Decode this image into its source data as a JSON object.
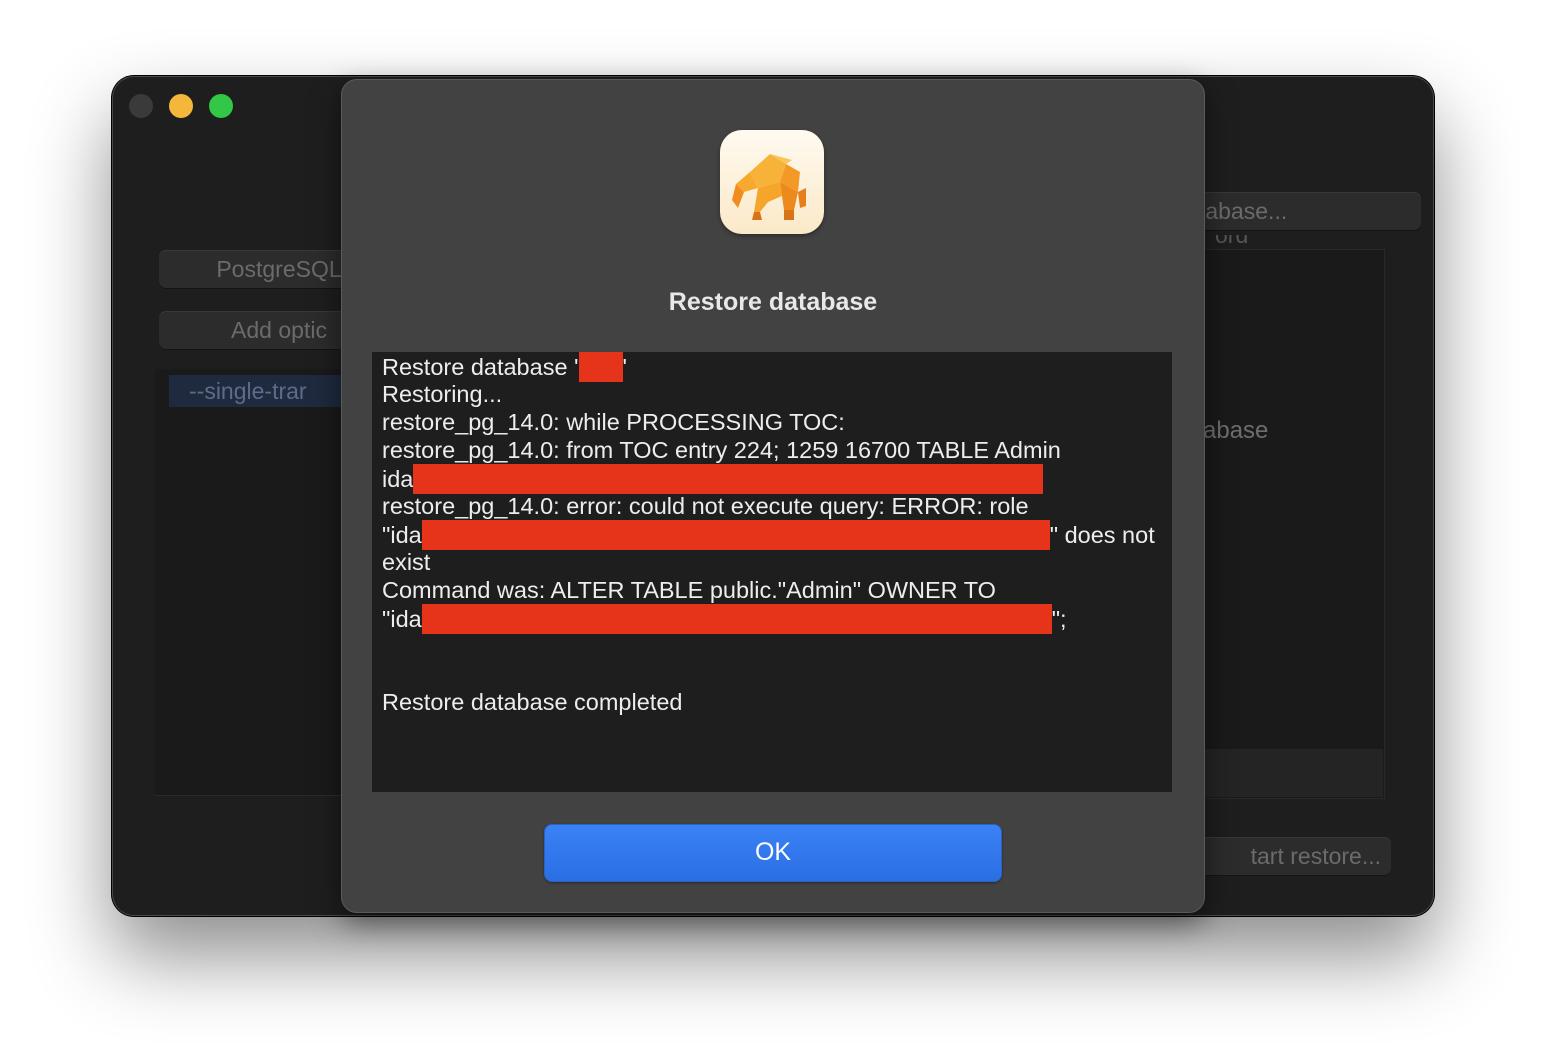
{
  "window": {
    "background_controls": {
      "select_database": "tabase...",
      "postgres_button": "PostgreSQL",
      "add_option_button": "Add optic",
      "option_item": "--single-trar",
      "right_top_text": "ord",
      "right_label": "abase",
      "start_restore_button": "tart restore..."
    }
  },
  "dialog": {
    "icon": "elephant-app-icon",
    "title": "Restore database",
    "log": {
      "line1_prefix": "Restore database '",
      "line1_suffix": "'",
      "line2": "Restoring...",
      "line3": "restore_pg_14.0: while PROCESSING TOC:",
      "line4": "restore_pg_14.0: from TOC entry 224; 1259 16700 TABLE Admin",
      "line5_prefix": "ida",
      "line6": "restore_pg_14.0: error: could not execute query: ERROR:  role",
      "line7_prefix": "\"ida",
      "line7_suffix": "\" does not",
      "line8": "exist",
      "line9": "Command was: ALTER TABLE public.\"Admin\" OWNER TO",
      "line10_prefix": "\"ida",
      "line10_suffix": "\";",
      "line11": "Restore database completed"
    },
    "ok_button": "OK"
  },
  "colors": {
    "redaction": "#e6341b",
    "ok_button": "#2f74ea",
    "dialog_bg": "#424242",
    "log_bg": "#1e1e1e"
  }
}
